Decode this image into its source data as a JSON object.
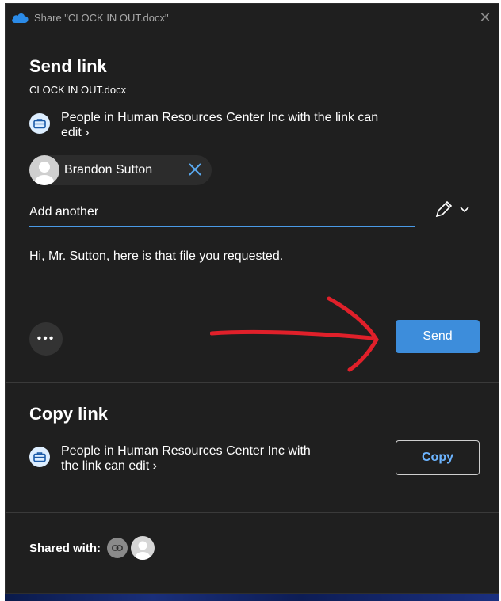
{
  "window": {
    "title": "Share \"CLOCK IN OUT.docx\"",
    "close_glyph": "✕"
  },
  "send_link": {
    "heading": "Send link",
    "filename": "CLOCK IN OUT.docx",
    "permission_line1": "People in Human Resources Center Inc with the link can",
    "permission_line2": "edit ›",
    "recipient": {
      "name": "Brandon Sutton"
    },
    "add_placeholder": "Add another",
    "message": "Hi, Mr. Sutton, here is that file you requested.",
    "more_glyph": "•••",
    "send_label": "Send"
  },
  "copy_link": {
    "heading": "Copy link",
    "permission_line1": "People in Human Resources Center Inc with",
    "permission_line2": "the link can edit ›",
    "copy_label": "Copy"
  },
  "shared_with": {
    "label": "Shared with:"
  },
  "colors": {
    "background": "#1f1f1f",
    "accent": "#3d8ddb",
    "link_text": "#6cb4ff",
    "annotation_arrow": "#e0202a"
  },
  "icons": [
    "onedrive-cloud-icon",
    "close-icon",
    "briefcase-icon",
    "person-icon",
    "remove-icon",
    "pencil-icon",
    "chevron-down-icon",
    "more-icon",
    "link-icon"
  ]
}
